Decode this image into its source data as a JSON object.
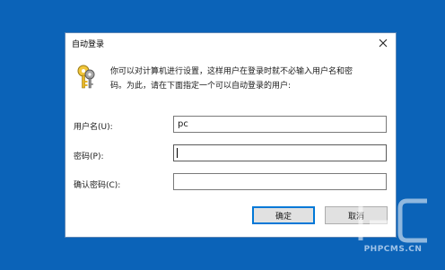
{
  "dialog": {
    "title": "自动登录",
    "description_line1": "你可以对计算机进行设置，这样用户在登录时就不必输入用户名和密",
    "description_line2": "码。为此，请在下面指定一个可以自动登录的用户:",
    "fields": [
      {
        "label": "用户名(U):",
        "value": ""
      },
      {
        "label": "密码(P):",
        "value": ""
      },
      {
        "label": "确认密码(C):",
        "value": ""
      }
    ],
    "username_value": "pc",
    "ok_label": "确定",
    "cancel_label": "取消"
  },
  "watermark": {
    "text": "PHPCMS.CN"
  },
  "icons": {
    "close": "close-icon",
    "keys": "keys-icon"
  },
  "colors": {
    "desktop": "#0b63b8",
    "accent": "#0078d7"
  }
}
